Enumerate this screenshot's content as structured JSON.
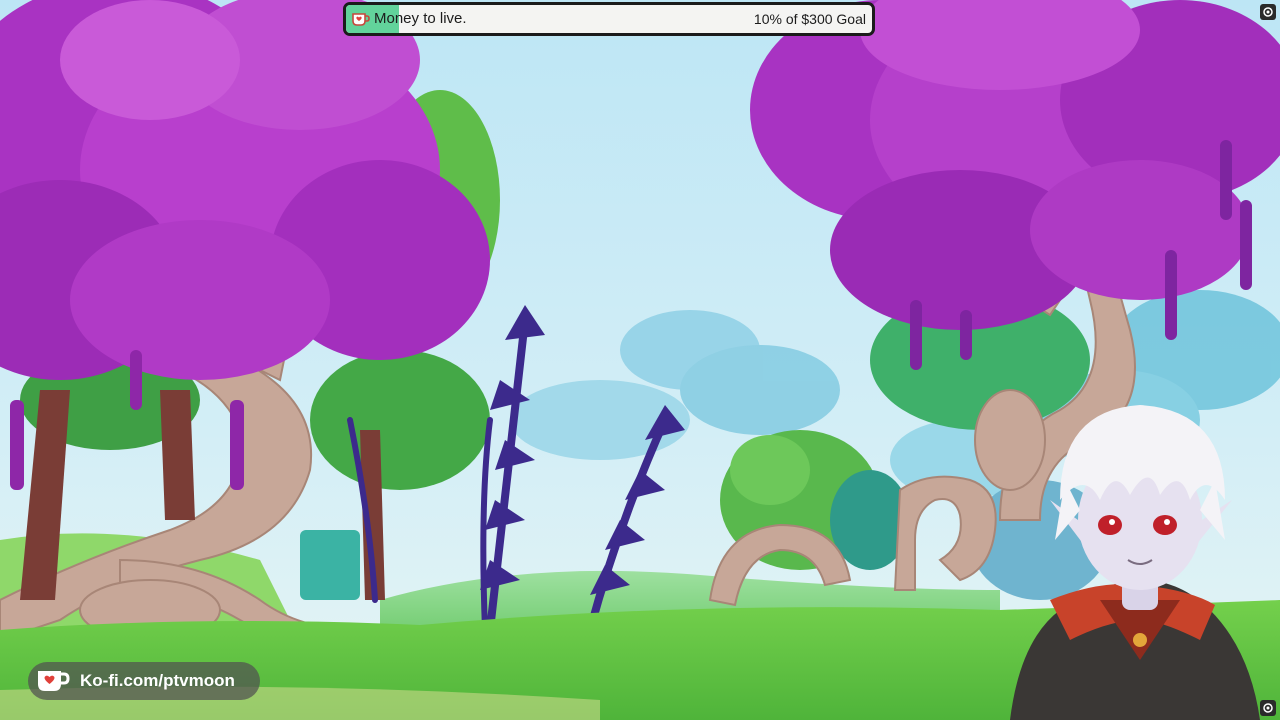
{
  "goal": {
    "title": "Money to live.",
    "status": "10% of $300 Goal",
    "progress_fraction": 0.1,
    "fill_color": "#62d39b",
    "icon": "kofi-cup-icon"
  },
  "kofi": {
    "link_text": "Ko-fi.com/ptvmoon",
    "icon": "kofi-cup-icon"
  },
  "colors": {
    "sky": "#bfe3f0",
    "foliage_magenta": "#b03cc8",
    "grass": "#63c948",
    "bark": "#c9a898"
  },
  "corner_icons": [
    "screen-capture-icon",
    "screen-capture-icon"
  ]
}
